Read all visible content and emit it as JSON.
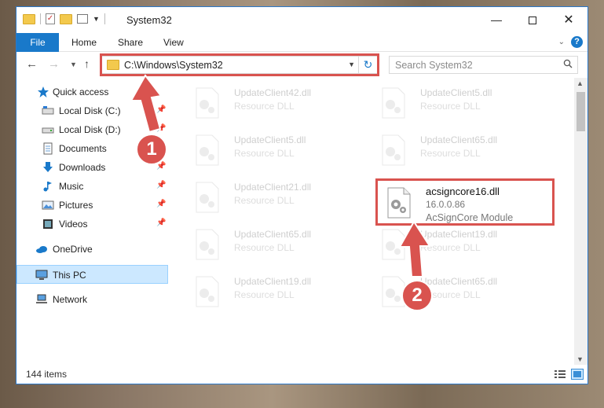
{
  "window": {
    "title": "System32",
    "controls": {
      "minimize": "—",
      "maximize": "",
      "close": "✕"
    }
  },
  "ribbon": {
    "tabs": [
      "File",
      "Home",
      "Share",
      "View"
    ]
  },
  "address": {
    "path": "C:\\Windows\\System32",
    "refresh_icon": "↻"
  },
  "search": {
    "placeholder": "Search System32"
  },
  "sidebar": {
    "items": [
      {
        "label": "Quick access",
        "icon": "star-icon",
        "pinned": false
      },
      {
        "label": "Local Disk (C:)",
        "icon": "drive-icon",
        "pinned": true
      },
      {
        "label": "Local Disk (D:)",
        "icon": "drive-icon",
        "pinned": true
      },
      {
        "label": "Documents",
        "icon": "documents-icon",
        "pinned": true
      },
      {
        "label": "Downloads",
        "icon": "download-icon",
        "pinned": true
      },
      {
        "label": "Music",
        "icon": "music-icon",
        "pinned": true
      },
      {
        "label": "Pictures",
        "icon": "pictures-icon",
        "pinned": true
      },
      {
        "label": "Videos",
        "icon": "videos-icon",
        "pinned": true
      },
      {
        "label": "OneDrive",
        "icon": "cloud-icon",
        "pinned": false
      },
      {
        "label": "This PC",
        "icon": "pc-icon",
        "pinned": false,
        "selected": true
      },
      {
        "label": "Network",
        "icon": "network-icon",
        "pinned": false
      }
    ]
  },
  "files": [
    {
      "name": "UpdateClient42.dll",
      "desc": "Resource DLL"
    },
    {
      "name": "UpdateClient5.dll",
      "desc": "Resource DLL"
    },
    {
      "name": "UpdateClient5.dll",
      "desc": "Resource DLL"
    },
    {
      "name": "UpdateClient65.dll",
      "desc": "Resource DLL"
    },
    {
      "name": "UpdateClient21.dll",
      "desc": "Resource DLL"
    },
    {
      "name": "acsigncore16.dll",
      "version": "16.0.0.86",
      "desc": "AcSignCore Module"
    },
    {
      "name": "UpdateClient65.dll",
      "desc": "Resource DLL"
    },
    {
      "name": "UpdateClient19.dll",
      "desc": "Resource DLL"
    },
    {
      "name": "UpdateClient19.dll",
      "desc": "Resource DLL"
    },
    {
      "name": "UpdateClient65.dll",
      "desc": "Resource DLL"
    }
  ],
  "status": {
    "count": "144 items"
  },
  "callouts": [
    "1",
    "2"
  ],
  "colors": {
    "accent": "#1979ca",
    "annotation": "#d9534f",
    "selected": "#cce8ff"
  }
}
